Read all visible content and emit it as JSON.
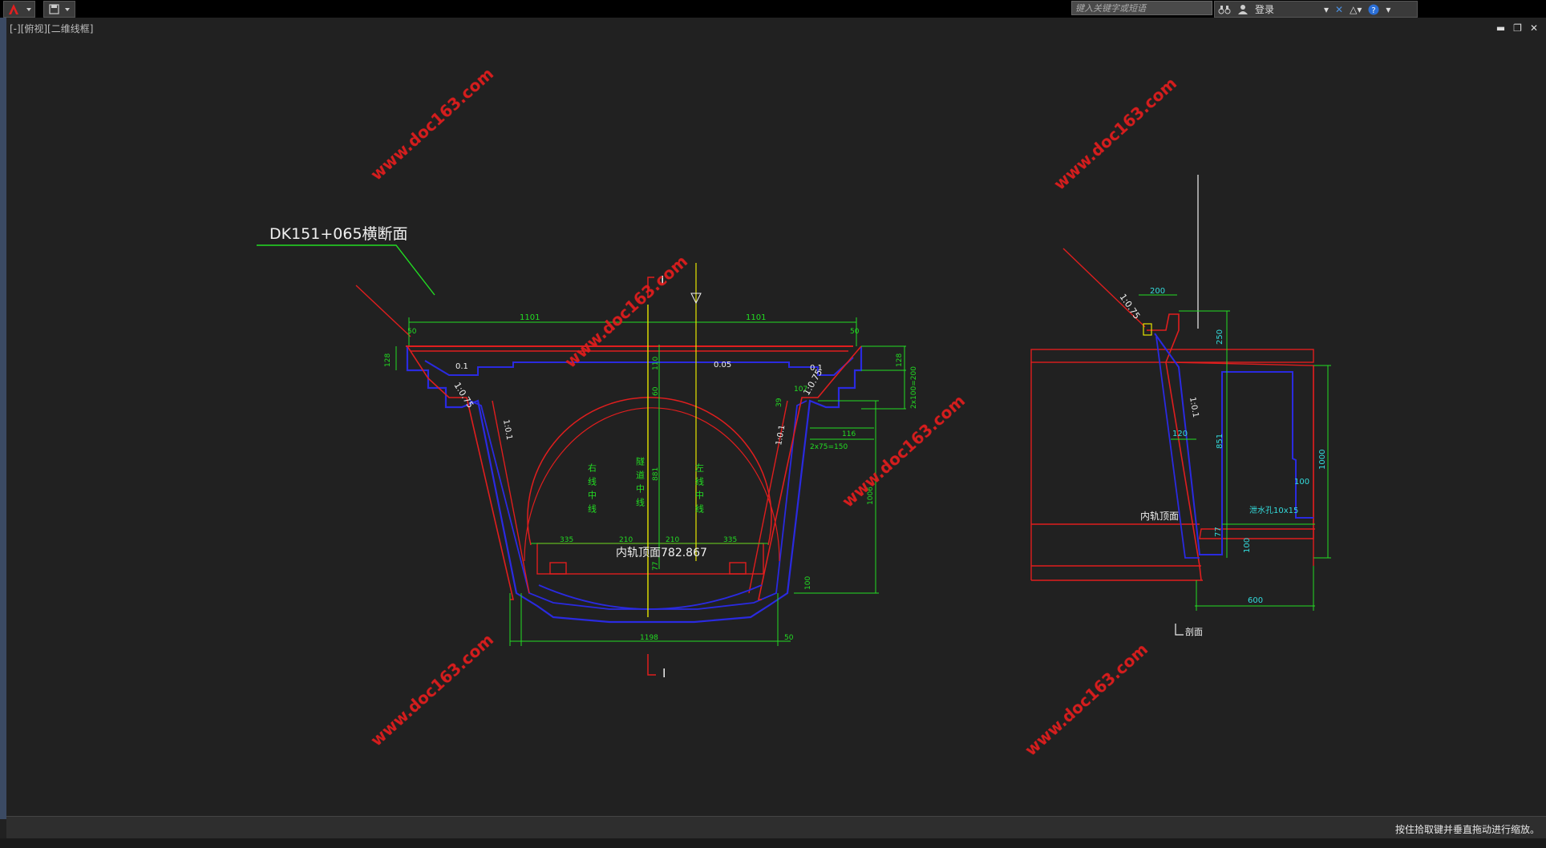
{
  "titlebar": {
    "app_menu_icon": "autocad-a-icon",
    "quick_access_icon": "save-icon",
    "search_placeholder": "键入关键字或短语",
    "login_label": "登录"
  },
  "viewport": {
    "label": "[-][俯视][二维线框]"
  },
  "drawing": {
    "section_title": "DK151+065横断面",
    "section_mark": "I",
    "top_dims": [
      "1101",
      "1101"
    ],
    "dims": {
      "d50": "50",
      "d128": "128",
      "d01": "0.1",
      "d005": "0.05",
      "slope075": "1:0.75",
      "slope01": "1:0.1",
      "d2x100": "2x100=200",
      "d116": "116",
      "d2x75": "2x75=150",
      "d1006": "1006",
      "d335": "335",
      "d210": "210",
      "d881": "881",
      "d110": "110",
      "d60": "60",
      "d77": "77",
      "d1198": "1198",
      "d100": "100",
      "d39": "39",
      "d107": "107",
      "d100b": "100"
    },
    "center_labels": {
      "right_line": "右线中线",
      "tunnel_line": "隧道中线",
      "left_line": "左线中线"
    },
    "rail_top": "内轨顶面782.867",
    "side": {
      "d200": "200",
      "d250": "250",
      "d851": "851",
      "d120": "120",
      "d100": "100",
      "d1000": "1000",
      "d77": "77",
      "d100b": "100",
      "d600": "600",
      "slope075": "1:0.75",
      "slope01": "1:0.1",
      "rail_top": "内轨顶面",
      "drain": "泄水孔10x15",
      "section_name": "剖面"
    },
    "watermark": "www.doc163.com",
    "colors": {
      "red": "#e01e1e",
      "blue": "#2a2ae0",
      "green": "#22dd22",
      "cyan": "#33dddd",
      "yellow": "#e6e600",
      "white": "#f0f0f0"
    }
  },
  "status": {
    "message": "按住拾取键并垂直拖动进行缩放。"
  }
}
